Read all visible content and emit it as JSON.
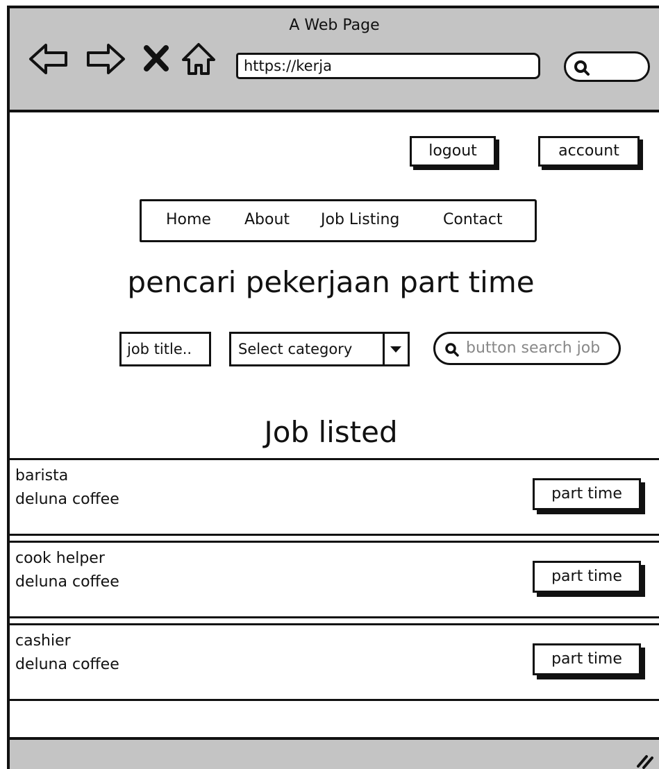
{
  "window": {
    "title": "A Web Page"
  },
  "browser": {
    "url": "https://kerja",
    "icons": [
      "back-arrow-icon",
      "forward-arrow-icon",
      "close-x-icon",
      "home-icon",
      "search-icon"
    ]
  },
  "header": {
    "logout_label": "logout",
    "account_label": "account"
  },
  "nav": {
    "items": [
      {
        "label": "Home"
      },
      {
        "label": "About"
      },
      {
        "label": "Job Listing"
      },
      {
        "label": "Contact"
      }
    ]
  },
  "hero": {
    "title": "pencari pekerjaan part time"
  },
  "filters": {
    "job_title_placeholder": "job title..",
    "category_selected": "Select category",
    "search_placeholder": "button search job"
  },
  "jobs": {
    "heading": "Job listed",
    "items": [
      {
        "title": "barista",
        "company": "deluna coffee",
        "type": "part time"
      },
      {
        "title": "cook helper",
        "company": "deluna coffee",
        "type": "part time"
      },
      {
        "title": "cashier",
        "company": "deluna coffee",
        "type": "part time"
      }
    ]
  },
  "colors": {
    "chrome": "#c4c4c4",
    "ink": "#111111",
    "placeholder": "#888888"
  }
}
